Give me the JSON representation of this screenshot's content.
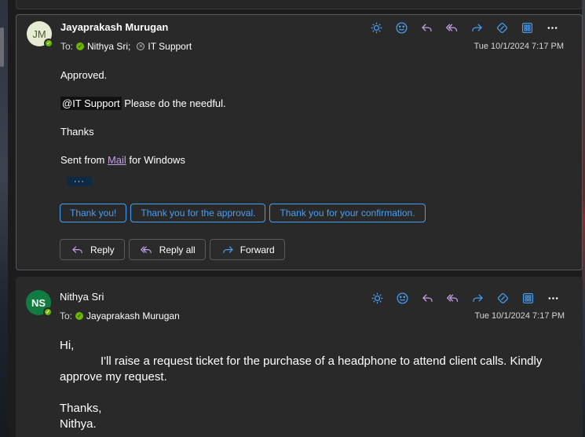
{
  "colors": {
    "accent": "#479ef5",
    "presence_available": "#6bb700",
    "link": "#c69fe6",
    "avatar_ns": "#107c41",
    "avatar_jm": "#e6ecd4"
  },
  "message1": {
    "avatar_initials": "JM",
    "sender": "Jayaprakash Murugan",
    "to_label": "To:",
    "recipients": [
      {
        "name": "Nithya Sri;",
        "status": "available"
      },
      {
        "name": "IT Support",
        "status": "unknown"
      }
    ],
    "datetime": "Tue 10/1/2024 7:17 PM",
    "body": {
      "line1": "Approved.",
      "mention": "@IT Support",
      "line2_rest": " Please do the needful.",
      "line3": "Thanks",
      "signature_prefix": "Sent from ",
      "signature_link": "Mail",
      "signature_suffix": " for Windows"
    },
    "expander": "···",
    "quick_replies": [
      "Thank you!",
      "Thank you for the approval.",
      "Thank you for your confirmation."
    ],
    "actions": {
      "reply": "Reply",
      "reply_all": "Reply all",
      "forward": "Forward"
    }
  },
  "message2": {
    "avatar_initials": "NS",
    "sender": "Nithya Sri",
    "to_label": "To:",
    "recipients": [
      {
        "name": "Jayaprakash Murugan",
        "status": "available"
      }
    ],
    "datetime": "Tue 10/1/2024 7:17 PM",
    "body": {
      "greeting": "Hi,",
      "paragraph": "I'll raise a request ticket for the purchase of a headphone to attend client calls. Kindly approve my request.",
      "closing": "Thanks,",
      "name": "Nithya."
    }
  },
  "icons": [
    "summary-icon",
    "emoji-icon",
    "reply-icon",
    "reply-all-icon",
    "forward-icon",
    "copilot-icon",
    "apps-icon",
    "more-icon"
  ]
}
